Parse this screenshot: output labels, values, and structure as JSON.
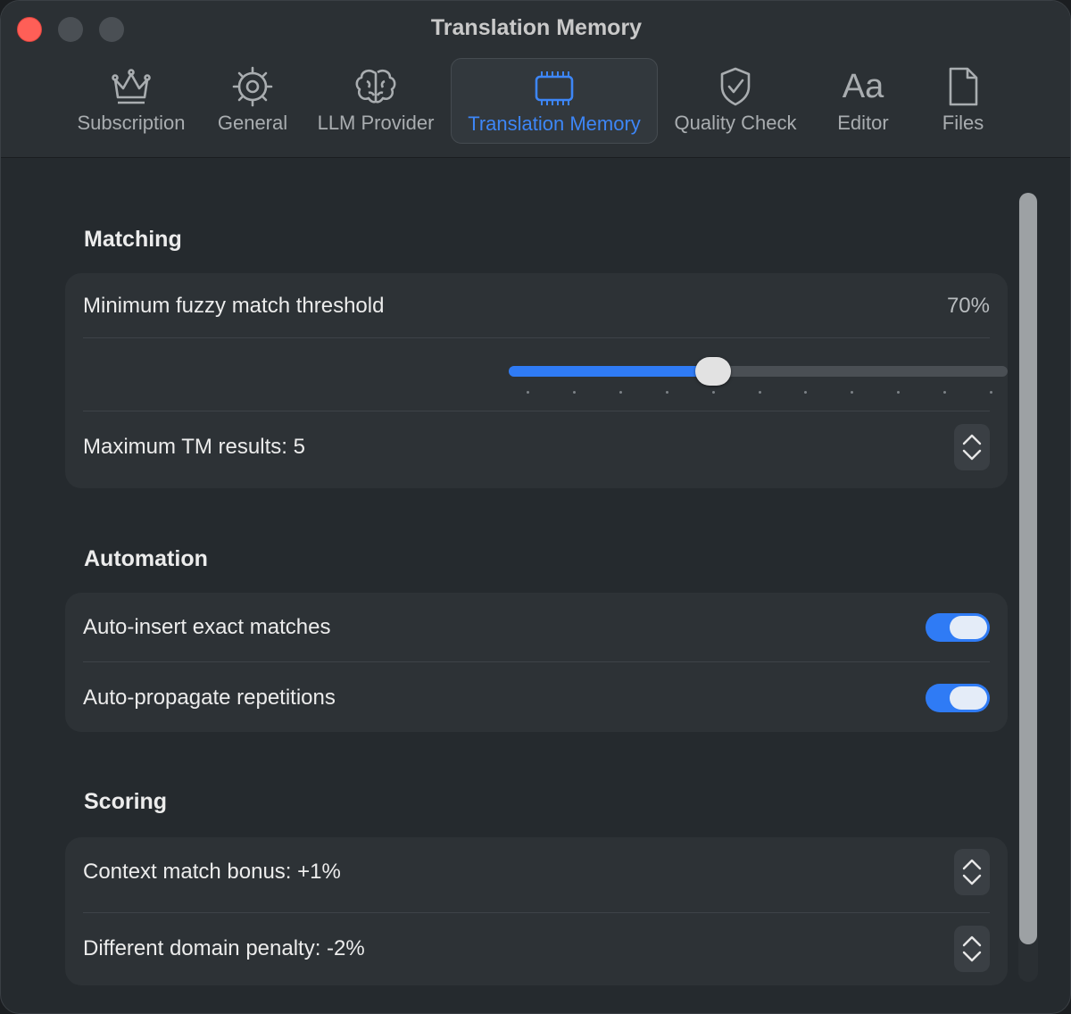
{
  "window": {
    "title": "Translation Memory"
  },
  "tabs": [
    {
      "label": "Subscription",
      "icon": "crown-icon"
    },
    {
      "label": "General",
      "icon": "gear-icon"
    },
    {
      "label": "LLM Provider",
      "icon": "brain-icon"
    },
    {
      "label": "Translation Memory",
      "icon": "memory-chip-icon",
      "active": true
    },
    {
      "label": "Quality Check",
      "icon": "shield-check-icon"
    },
    {
      "label": "Editor",
      "icon": "font-icon",
      "glyph": "Aa"
    },
    {
      "label": "Files",
      "icon": "document-icon"
    }
  ],
  "matching": {
    "title": "Matching",
    "threshold_label": "Minimum fuzzy match threshold",
    "threshold_value": "70%",
    "slider_fraction": 0.41,
    "max_results_label": "Maximum TM results: 5"
  },
  "automation": {
    "title": "Automation",
    "auto_insert_label": "Auto-insert exact matches",
    "auto_insert_on": true,
    "auto_propagate_label": "Auto-propagate repetitions",
    "auto_propagate_on": true
  },
  "scoring": {
    "title": "Scoring",
    "context_bonus_label": "Context match bonus: +1%",
    "domain_penalty_label": "Different domain penalty: -2%"
  },
  "colors": {
    "accent": "#2f7bf5",
    "close": "#fe5f57"
  }
}
